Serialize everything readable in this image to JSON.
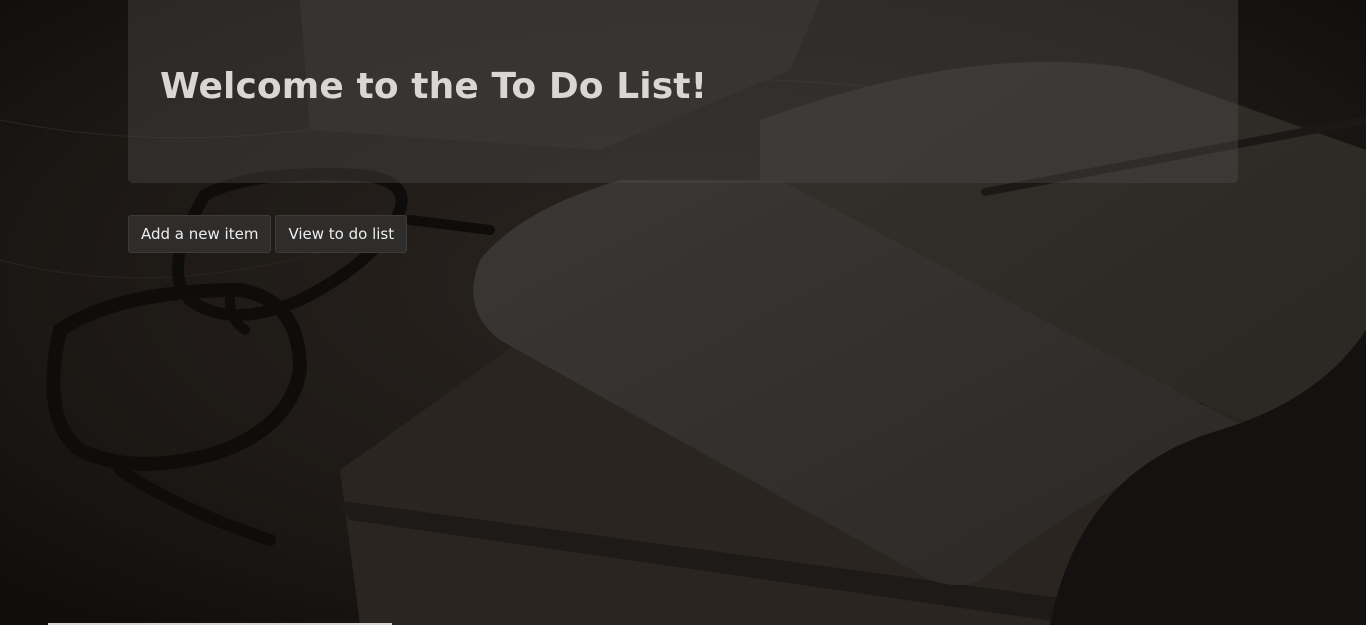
{
  "header": {
    "title": "Welcome to the To Do List!"
  },
  "actions": {
    "add_label": "Add a new item",
    "view_label": "View to do list"
  },
  "colors": {
    "background": "#1a1613",
    "panel": "#505050",
    "button": "#2f2d2b",
    "title_text": "#d9d7d5"
  }
}
